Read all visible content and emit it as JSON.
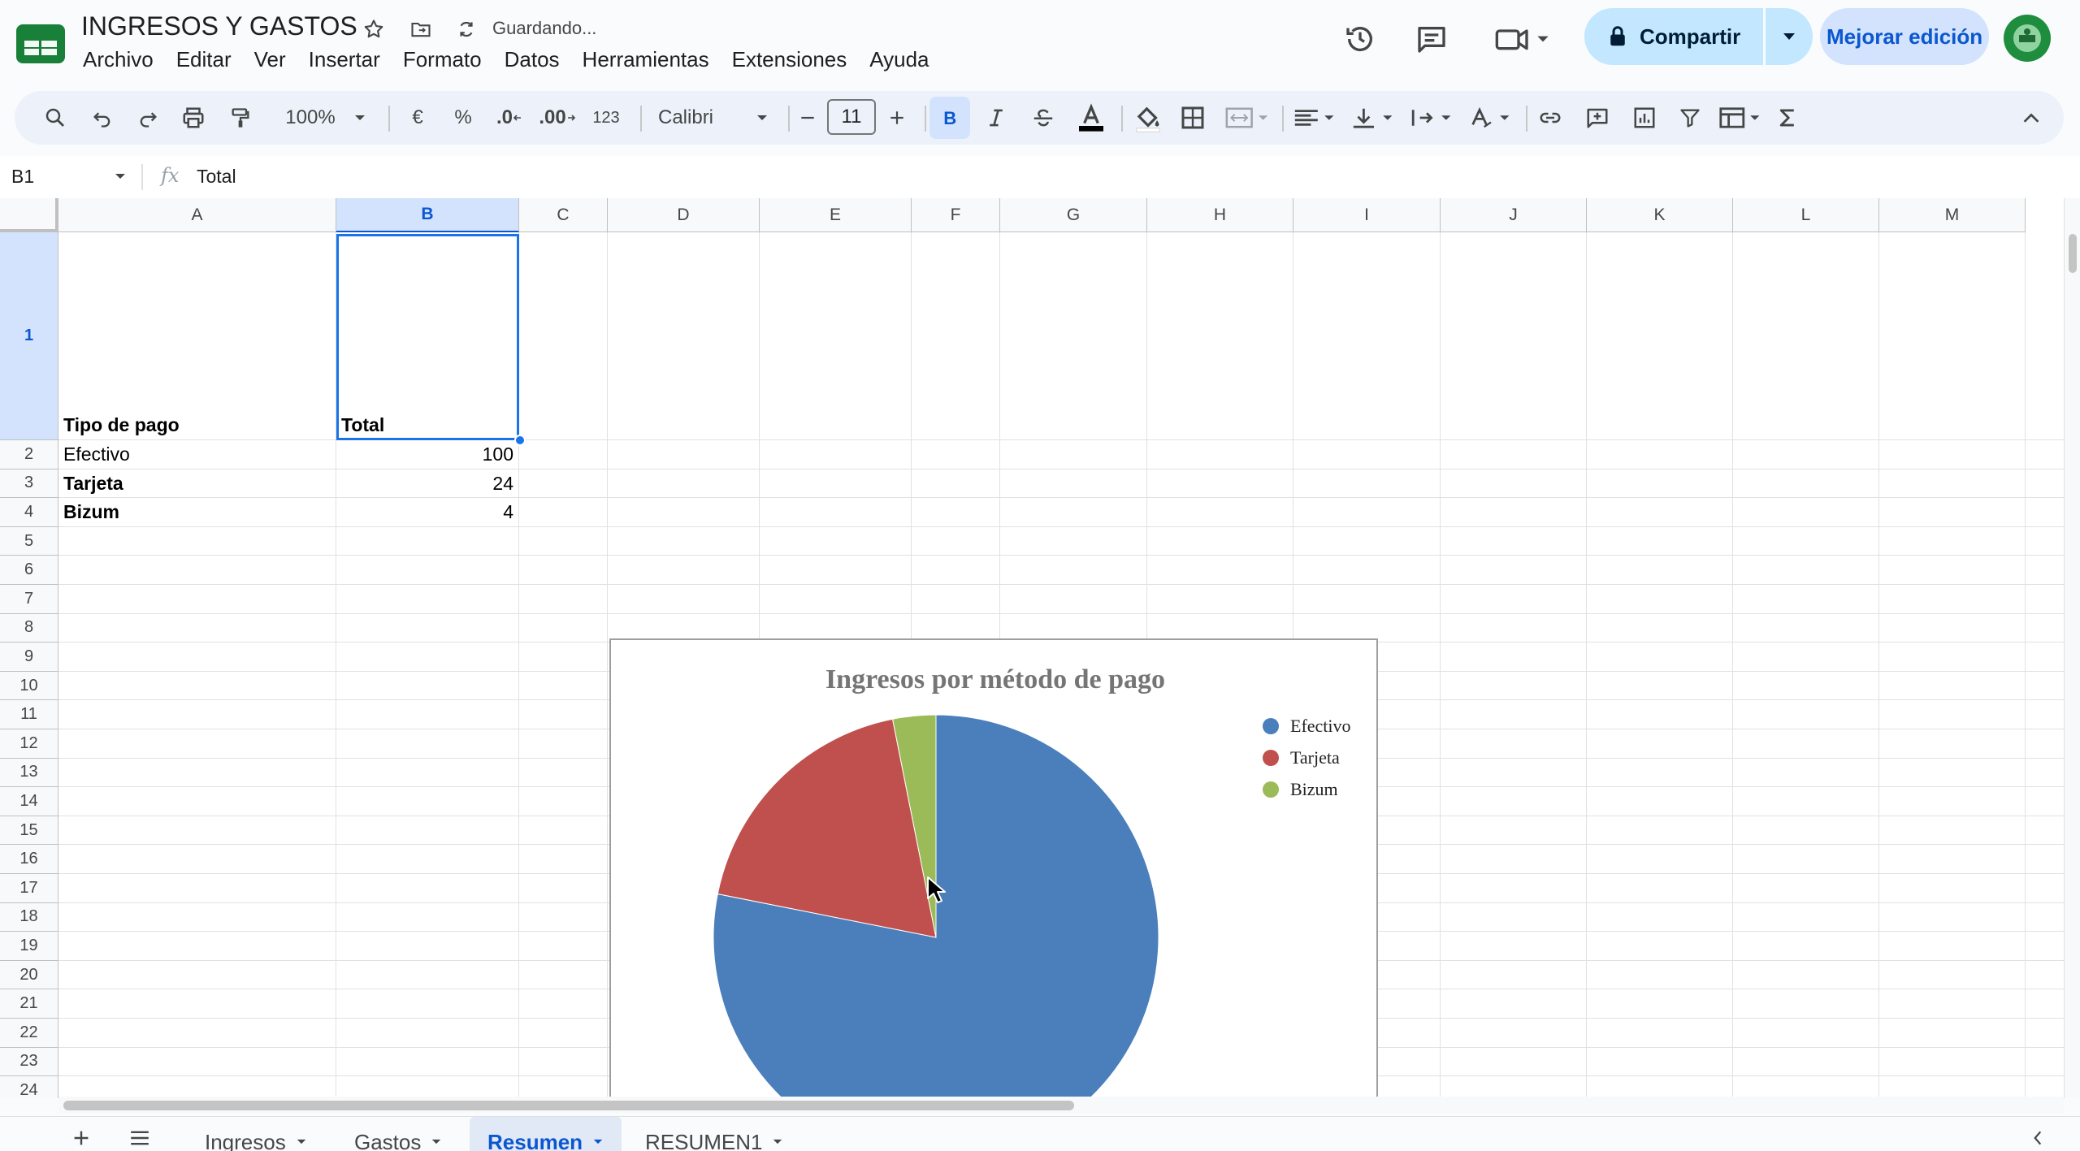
{
  "document": {
    "title": "INGRESOS Y GASTOS",
    "save_status": "Guardando..."
  },
  "menu": [
    "Archivo",
    "Editar",
    "Ver",
    "Insertar",
    "Formato",
    "Datos",
    "Herramientas",
    "Extensiones",
    "Ayuda"
  ],
  "header_actions": {
    "share_label": "Compartir",
    "upgrade_label": "Mejorar edición"
  },
  "toolbar": {
    "zoom": "100%",
    "currency_label": "€",
    "percent_label": "%",
    "decrease_decimals_label": ".0",
    "increase_decimals_label": ".00",
    "number_format_label": "123",
    "font_family": "Calibri",
    "font_size": "11",
    "bold_active": true
  },
  "formula_bar": {
    "name_box": "B1",
    "fx_label": "fx",
    "formula": "Total"
  },
  "columns": [
    "A",
    "B",
    "C",
    "D",
    "E",
    "F",
    "G",
    "H",
    "I",
    "J",
    "K",
    "L",
    "M"
  ],
  "rows": [
    "1",
    "2",
    "3",
    "4",
    "5",
    "6",
    "7",
    "8",
    "9",
    "10",
    "11",
    "12",
    "13",
    "14",
    "15",
    "16",
    "17",
    "18",
    "19",
    "20",
    "21",
    "22",
    "23",
    "24"
  ],
  "selected": {
    "column": "B",
    "row": "1"
  },
  "cells": {
    "A1": "Tipo de pago",
    "B1": "Total",
    "A2": "Efectivo",
    "B2": "100",
    "A3": "Tarjeta",
    "B3": "24",
    "A4": "Bizum",
    "B4": "4"
  },
  "chart_data": {
    "type": "pie",
    "title": "Ingresos por método de pago",
    "categories": [
      "Efectivo",
      "Tarjeta",
      "Bizum"
    ],
    "values": [
      100,
      24,
      4
    ],
    "colors": [
      "#4a7fbc",
      "#c0504d",
      "#9bbb59"
    ],
    "legend_position": "top-right"
  },
  "sheets": [
    {
      "label": "Ingresos",
      "active": false
    },
    {
      "label": "Gastos",
      "active": false
    },
    {
      "label": "Resumen",
      "active": true
    },
    {
      "label": "RESUMEN1",
      "active": false
    }
  ],
  "icons": [
    "app-logo-icon",
    "star-icon",
    "move-folder-icon",
    "saving-sync-icon",
    "history-icon",
    "comments-icon",
    "meet-video-icon",
    "lock-icon",
    "avatar-icon"
  ]
}
